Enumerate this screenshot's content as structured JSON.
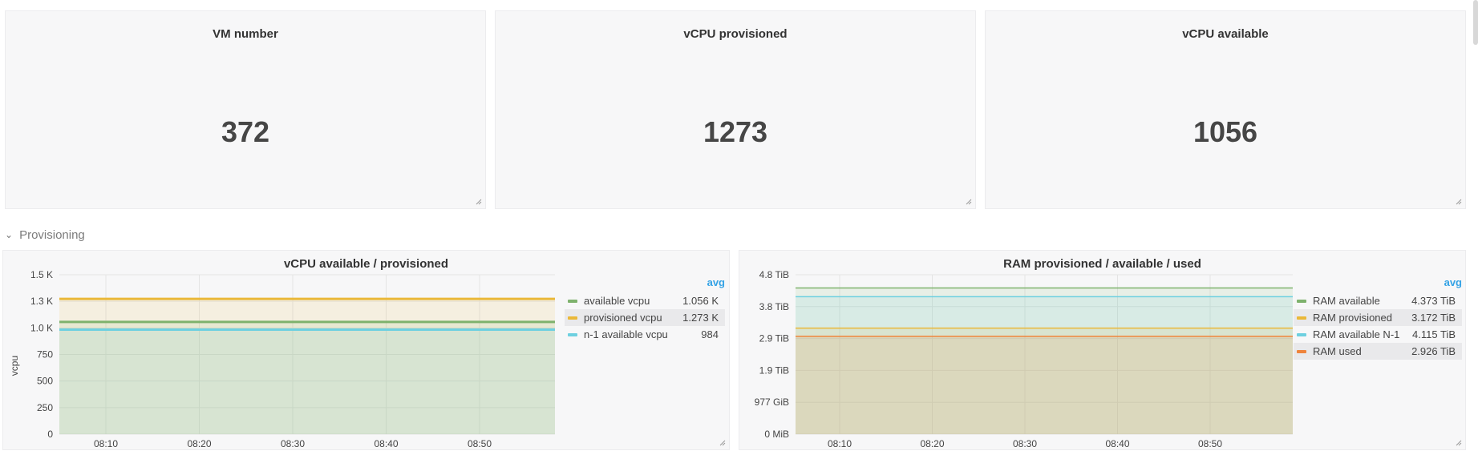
{
  "stats": [
    {
      "title": "VM number",
      "value": "372"
    },
    {
      "title": "vCPU provisioned",
      "value": "1273"
    },
    {
      "title": "vCPU available",
      "value": "1056"
    }
  ],
  "row": {
    "title": "Provisioning"
  },
  "vcpu_panel": {
    "title": "vCPU available / provisioned",
    "legend_header": "avg",
    "legend": [
      {
        "name": "available vcpu",
        "value": "1.056 K",
        "color": "#7eb26d"
      },
      {
        "name": "provisioned vcpu",
        "value": "1.273 K",
        "color": "#eab839"
      },
      {
        "name": "n-1 available vcpu",
        "value": "984",
        "color": "#6ed0e0"
      }
    ]
  },
  "ram_panel": {
    "title": "RAM provisioned / available / used",
    "legend_header": "avg",
    "legend": [
      {
        "name": "RAM available",
        "value": "4.373 TiB",
        "color": "#7eb26d"
      },
      {
        "name": "RAM provisioned",
        "value": "3.172 TiB",
        "color": "#eab839"
      },
      {
        "name": "RAM available N-1",
        "value": "4.115 TiB",
        "color": "#6ed0e0"
      },
      {
        "name": "RAM used",
        "value": "2.926 TiB",
        "color": "#ef843c"
      }
    ]
  },
  "chart_data": [
    {
      "type": "area",
      "title": "vCPU available / provisioned",
      "ylabel": "vcpu",
      "xlabel": "",
      "x_ticks": [
        "08:10",
        "08:20",
        "08:30",
        "08:40",
        "08:50"
      ],
      "y_ticks": [
        "0",
        "250",
        "500",
        "750",
        "1.0 K",
        "1.3 K",
        "1.5 K"
      ],
      "ylim": [
        0,
        1500
      ],
      "series": [
        {
          "name": "available vcpu",
          "color": "#7eb26d",
          "values": [
            1056,
            1056,
            1056,
            1056,
            1056,
            1056
          ]
        },
        {
          "name": "provisioned vcpu",
          "color": "#eab839",
          "values": [
            1273,
            1273,
            1273,
            1273,
            1273,
            1273
          ]
        },
        {
          "name": "n-1 available vcpu",
          "color": "#6ed0e0",
          "values": [
            984,
            984,
            984,
            984,
            984,
            984
          ]
        }
      ],
      "grid": true,
      "legend_position": "right"
    },
    {
      "type": "area",
      "title": "RAM provisioned / available / used",
      "ylabel": "",
      "xlabel": "",
      "x_ticks": [
        "08:10",
        "08:20",
        "08:30",
        "08:40",
        "08:50"
      ],
      "y_ticks": [
        "0 MiB",
        "977 GiB",
        "1.9 TiB",
        "2.9 TiB",
        "3.8 TiB",
        "4.8 TiB"
      ],
      "ylim": [
        0,
        4.77
      ],
      "series": [
        {
          "name": "RAM available",
          "color": "#7eb26d",
          "values": [
            4.373,
            4.373,
            4.373,
            4.373,
            4.373,
            4.373
          ]
        },
        {
          "name": "RAM provisioned",
          "color": "#eab839",
          "values": [
            3.172,
            3.172,
            3.172,
            3.172,
            3.172,
            3.172
          ]
        },
        {
          "name": "RAM available N-1",
          "color": "#6ed0e0",
          "values": [
            4.115,
            4.115,
            4.115,
            4.115,
            4.115,
            4.115
          ]
        },
        {
          "name": "RAM used",
          "color": "#ef843c",
          "values": [
            2.926,
            2.926,
            2.926,
            2.926,
            2.926,
            2.926
          ]
        }
      ],
      "grid": true,
      "legend_position": "right"
    }
  ]
}
